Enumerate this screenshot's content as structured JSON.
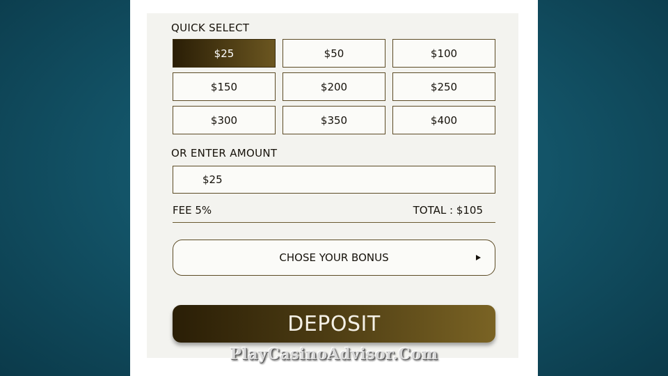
{
  "quick_select": {
    "title": "QUICK SELECT",
    "amounts": [
      {
        "label": "$25",
        "selected": true
      },
      {
        "label": "$50",
        "selected": false
      },
      {
        "label": "$100",
        "selected": false
      },
      {
        "label": "$150",
        "selected": false
      },
      {
        "label": "$200",
        "selected": false
      },
      {
        "label": "$250",
        "selected": false
      },
      {
        "label": "$300",
        "selected": false
      },
      {
        "label": "$350",
        "selected": false
      },
      {
        "label": "$400",
        "selected": false
      }
    ]
  },
  "custom_amount": {
    "title": "OR ENTER AMOUNT",
    "value": "$25"
  },
  "summary": {
    "fee": "FEE 5%",
    "total": "TOTAL : $105"
  },
  "bonus": {
    "label": "CHOSE YOUR BONUS",
    "arrow_icon": "play-arrow-icon"
  },
  "deposit": {
    "label": "DEPOSIT"
  },
  "watermark": "PlayCasinoAdvisor.Com",
  "colors": {
    "accent_dark": "#2a1e06",
    "accent_light": "#7a6324",
    "background": "#135468",
    "panel": "#f3f3ef"
  }
}
